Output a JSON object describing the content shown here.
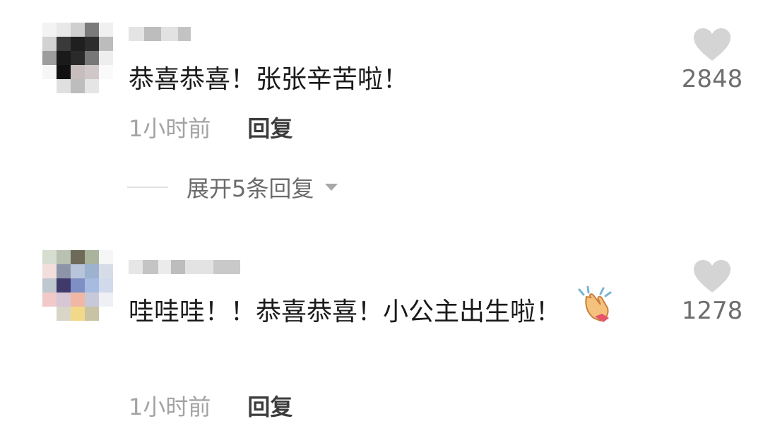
{
  "comments": [
    {
      "content": "恭喜恭喜！张张辛苦啦！",
      "time": "1小时前",
      "reply_label": "回复",
      "like_count": "2848"
    },
    {
      "content": "哇哇哇！！恭喜恭喜！小公主出生啦！",
      "emoji": "clapping-hands-emoji",
      "time": "1小时前",
      "reply_label": "回复",
      "like_count": "1278"
    }
  ],
  "expand_replies_label": "展开5条回复",
  "icons": {
    "like": "heart-icon",
    "expand": "caret-down-icon"
  },
  "colors": {
    "text_primary": "#1a1a1a",
    "text_muted": "#a3a3a3",
    "heart": "#d4d4d4",
    "like_count": "#6e6e6e"
  }
}
